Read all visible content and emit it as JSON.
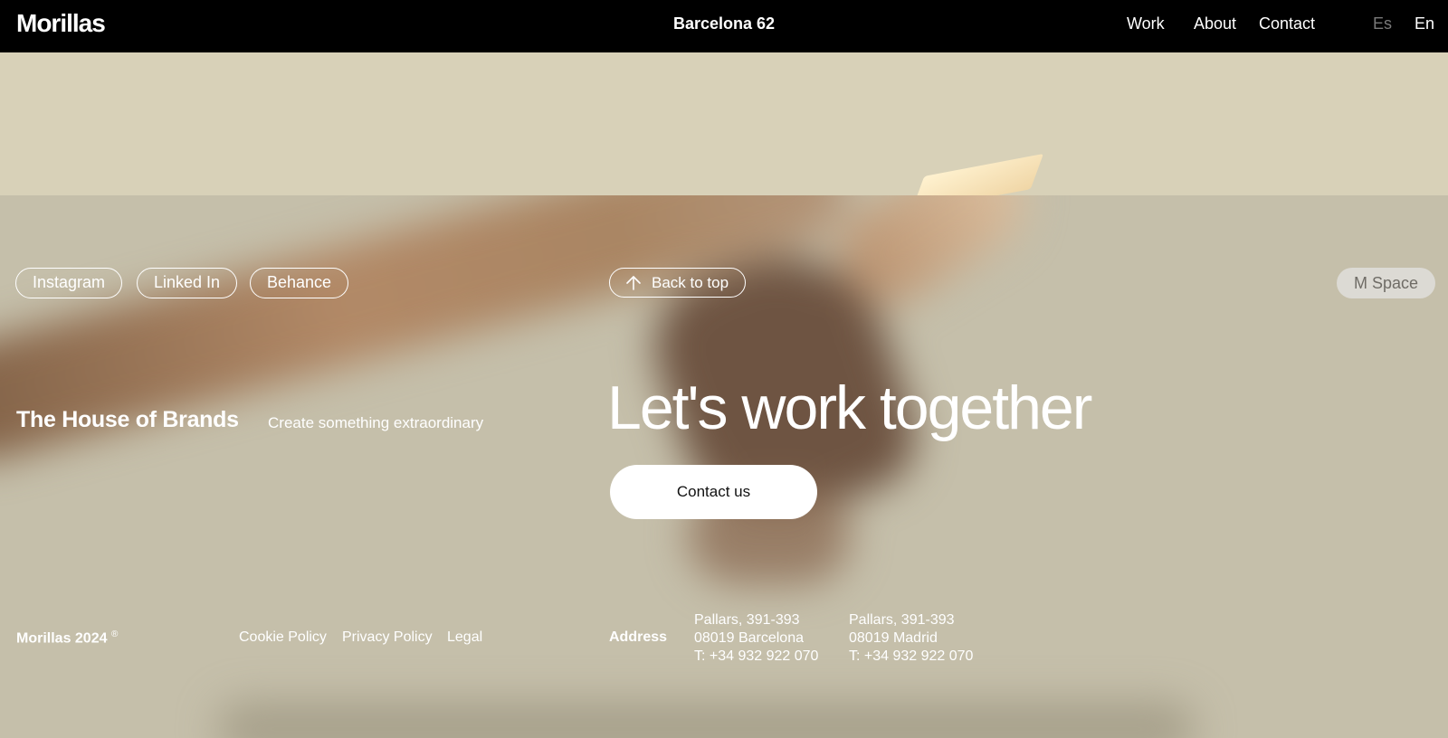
{
  "header": {
    "logo": "Morillas",
    "location": "Barcelona 62",
    "nav": {
      "work": "Work",
      "about": "About",
      "contact": "Contact"
    },
    "languages": {
      "es": "Es",
      "en": "En"
    }
  },
  "footer": {
    "social": {
      "instagram": "Instagram",
      "linkedin": "Linked In",
      "behance": "Behance"
    },
    "back_to_top": "Back to top",
    "mspace": "M Space",
    "brand_title": "The House of Brands",
    "brand_tagline": "Create something extraordinary",
    "heading": "Let's work together",
    "contact_button": "Contact us",
    "copyright": "Morillas 2024",
    "copyright_mark": "®",
    "legal_links": {
      "cookie": "Cookie Policy",
      "privacy": "Privacy Policy",
      "legal": "Legal"
    },
    "address_label": "Address",
    "addresses": [
      {
        "street": "Pallars, 391-393",
        "city": "08019 Barcelona",
        "phone": "T: +34 932 922 070"
      },
      {
        "street": "Pallars, 391-393",
        "city": "08019 Madrid",
        "phone": "T: +34 932 922 070"
      }
    ]
  },
  "colors": {
    "header_bg": "#000000",
    "hero_bg": "#d8d1b8",
    "footer_bg": "#c5bfaa",
    "mspace_bg": "#dcdad4",
    "inactive_lang": "#7a7a7a"
  }
}
